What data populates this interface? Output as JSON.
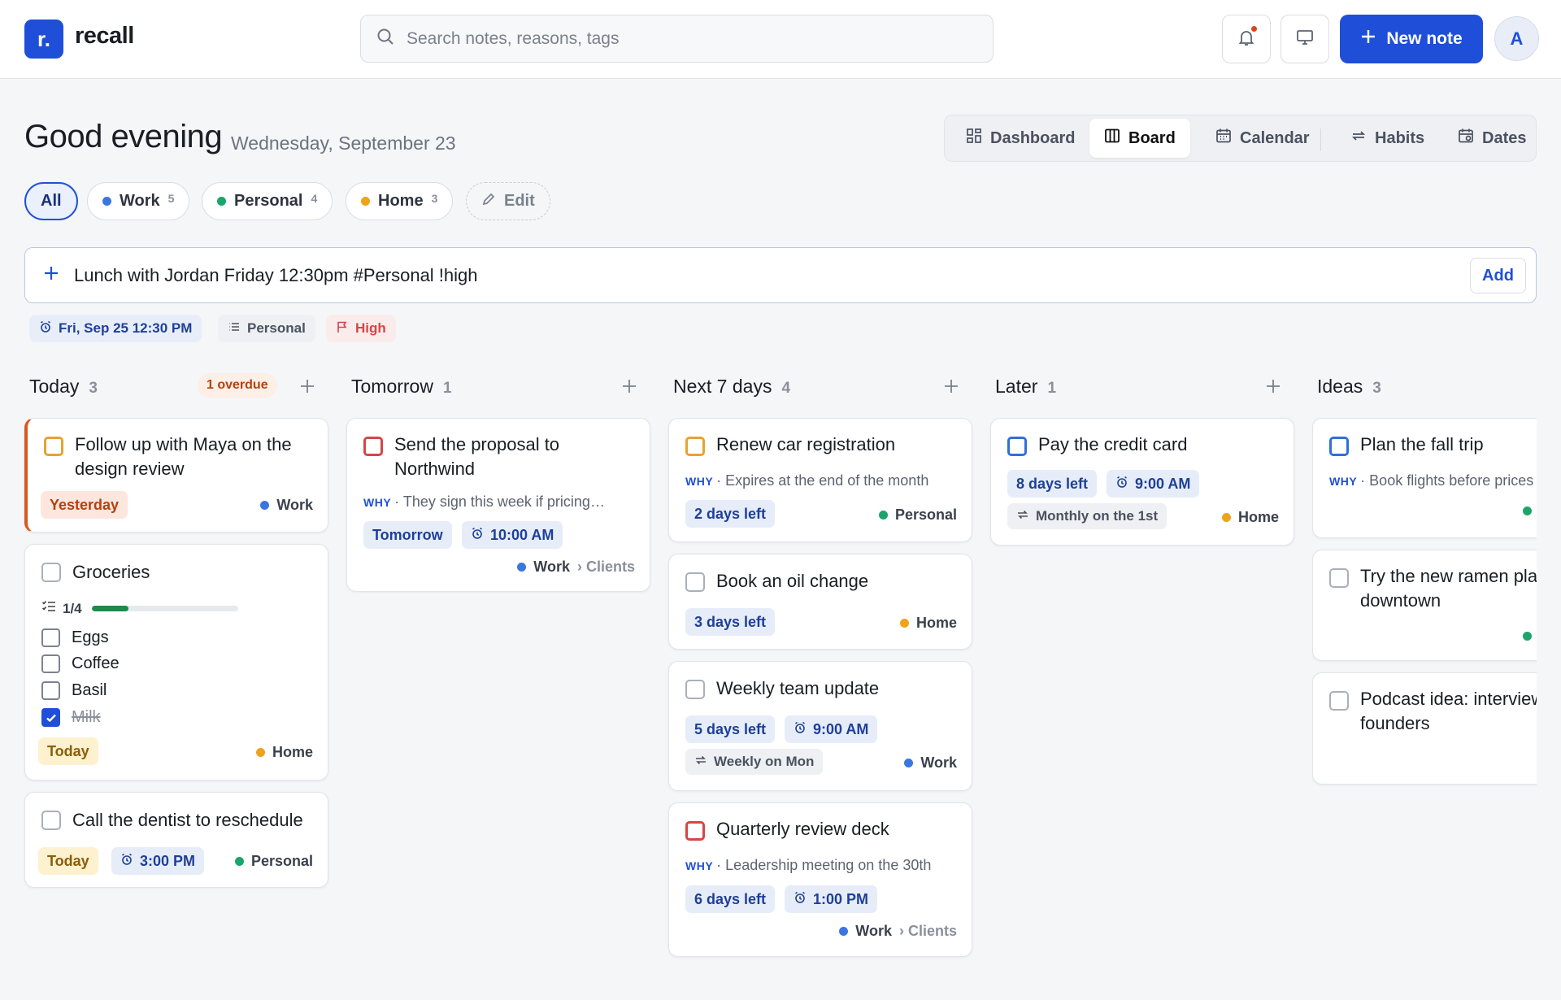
{
  "app": {
    "logo_letter": "r.",
    "name": "recall"
  },
  "search": {
    "placeholder": "Search notes, reasons, tags"
  },
  "topbar": {
    "new_note_label": "New note",
    "avatar_initial": "A"
  },
  "header": {
    "greeting": "Good evening",
    "date": "Wednesday, September 23"
  },
  "views": [
    {
      "label": "Dashboard",
      "icon": "dashboard-icon",
      "active": false
    },
    {
      "label": "Board",
      "icon": "board-icon",
      "active": true
    },
    {
      "label": "Calendar",
      "icon": "calendar-icon",
      "active": false
    },
    {
      "label": "Habits",
      "icon": "repeat-icon",
      "active": false
    },
    {
      "label": "Dates",
      "icon": "dates-icon",
      "active": false
    }
  ],
  "filters": {
    "all": "All",
    "chips": [
      {
        "label": "Work",
        "count": "5",
        "color": "#3b76e0"
      },
      {
        "label": "Personal",
        "count": "4",
        "color": "#1aa56b"
      },
      {
        "label": "Home",
        "count": "3",
        "color": "#eea31a"
      }
    ],
    "edit": "Edit"
  },
  "quick_add": {
    "value": "Lunch with Jordan Friday 12:30pm #Personal !high",
    "button": "Add",
    "parsed": {
      "date": "Fri, Sep 25 12:30 PM",
      "category": "Personal",
      "priority": "High"
    }
  },
  "columns": [
    {
      "title": "Today",
      "count": "3",
      "badge": "1 overdue"
    },
    {
      "title": "Tomorrow",
      "count": "1"
    },
    {
      "title": "Next 7 days",
      "count": "4"
    },
    {
      "title": "Later",
      "count": "1"
    },
    {
      "title": "Ideas",
      "count": "3"
    }
  ],
  "cards": {
    "today": [
      {
        "title": "Follow up with Maya on the design review",
        "due": "Yesterday",
        "category": "Work"
      },
      {
        "title": "Groceries",
        "progress": "1/4",
        "progress_fraction": 0.25,
        "due": "Today",
        "category": "Home",
        "items": [
          {
            "label": "Eggs",
            "done": false
          },
          {
            "label": "Coffee",
            "done": false
          },
          {
            "label": "Basil",
            "done": false
          },
          {
            "label": "Milk",
            "done": true
          }
        ]
      },
      {
        "title": "Call the dentist to reschedule",
        "due": "Today",
        "time": "3:00 PM",
        "category": "Personal"
      }
    ],
    "tomorrow": [
      {
        "title": "Send the proposal to Northwind",
        "why_label": "WHY",
        "why": "They sign this week if pricing…",
        "due": "Tomorrow",
        "time": "10:00 AM",
        "category": "Work",
        "subcategory": "› Clients"
      }
    ],
    "next7": [
      {
        "title": "Renew car registration",
        "why_label": "WHY",
        "why": "Expires at the end of the month",
        "due": "2 days left",
        "category": "Personal"
      },
      {
        "title": "Book an oil change",
        "due": "3 days left",
        "category": "Home"
      },
      {
        "title": "Weekly team update",
        "due": "5 days left",
        "time": "9:00 AM",
        "repeat": "Weekly on Mon",
        "category": "Work"
      },
      {
        "title": "Quarterly review deck",
        "why_label": "WHY",
        "why": "Leadership meeting on the 30th",
        "due": "6 days left",
        "time": "1:00 PM",
        "category": "Work",
        "subcategory": "› Clients"
      }
    ],
    "later": [
      {
        "title": "Pay the credit card",
        "due": "8 days left",
        "time": "9:00 AM",
        "repeat": "Monthly on the 1st",
        "category": "Home"
      }
    ],
    "ideas": [
      {
        "title": "Plan the fall trip",
        "why_label": "WHY",
        "why": "Book flights before prices"
      },
      {
        "title": "Try the new ramen place downtown"
      },
      {
        "title": "Podcast idea: interview local founders"
      }
    ]
  },
  "colors": {
    "accent": "#1f4fd8",
    "work": "#3b76e0",
    "personal": "#1aa56b",
    "home": "#eea31a",
    "overdue": "#d9581f",
    "priority_high": "#d64545"
  }
}
